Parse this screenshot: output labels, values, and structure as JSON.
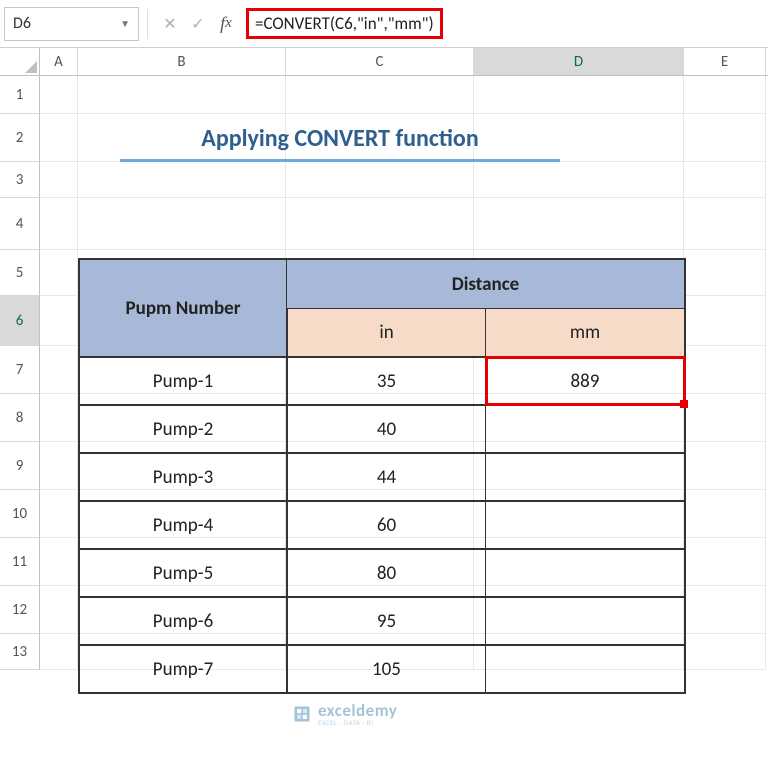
{
  "nameBox": {
    "value": "D6"
  },
  "formulaBar": {
    "formula": "=CONVERT(C6,\"in\",\"mm\")"
  },
  "columns": {
    "A": "A",
    "B": "B",
    "C": "C",
    "D": "D",
    "E": "E"
  },
  "rows": [
    "1",
    "2",
    "3",
    "4",
    "5",
    "6",
    "7",
    "8",
    "9",
    "10",
    "11",
    "12",
    "13"
  ],
  "title": "Applying CONVERT function",
  "table": {
    "header1": "Pupm Number",
    "header2": "Distance",
    "sub1": "in",
    "sub2": "mm",
    "rows": [
      {
        "name": "Pump-1",
        "in": "35",
        "mm": "889"
      },
      {
        "name": "Pump-2",
        "in": "40",
        "mm": ""
      },
      {
        "name": "Pump-3",
        "in": "44",
        "mm": ""
      },
      {
        "name": "Pump-4",
        "in": "60",
        "mm": ""
      },
      {
        "name": "Pump-5",
        "in": "80",
        "mm": ""
      },
      {
        "name": "Pump-6",
        "in": "95",
        "mm": ""
      },
      {
        "name": "Pump-7",
        "in": "105",
        "mm": ""
      }
    ]
  },
  "watermark": {
    "brand": "exceldemy",
    "tagline": "EXCEL · DATA · BI"
  },
  "chart_data": {
    "type": "table",
    "title": "Applying CONVERT function",
    "columns": [
      "Pupm Number",
      "in",
      "mm"
    ],
    "rows": [
      [
        "Pump-1",
        35,
        889
      ],
      [
        "Pump-2",
        40,
        null
      ],
      [
        "Pump-3",
        44,
        null
      ],
      [
        "Pump-4",
        60,
        null
      ],
      [
        "Pump-5",
        80,
        null
      ],
      [
        "Pump-6",
        95,
        null
      ],
      [
        "Pump-7",
        105,
        null
      ]
    ]
  }
}
